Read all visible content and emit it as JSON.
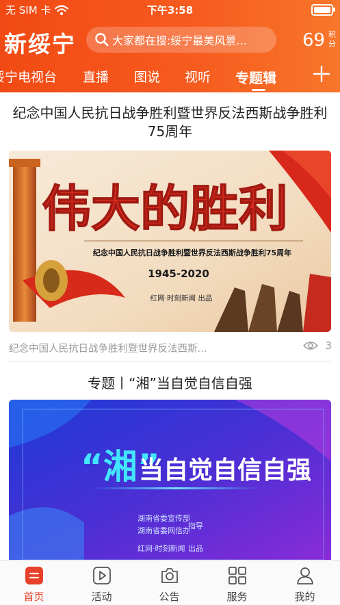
{
  "status_bar": {
    "carrier": "无 SIM 卡",
    "time": "下午3:58"
  },
  "header": {
    "logo": "新绥宁",
    "search_placeholder": "大家都在搜:绥宁最美风景...",
    "points_value": "69",
    "points_unit": "积分"
  },
  "tabs": [
    {
      "label": "绥宁电视台"
    },
    {
      "label": "直播"
    },
    {
      "label": "图说"
    },
    {
      "label": "视听"
    },
    {
      "label": "专题辑"
    }
  ],
  "active_tab": "专题辑",
  "feed": [
    {
      "title": "纪念中国人民抗日战争胜利暨世界反法西斯战争胜利75周年",
      "banner": {
        "headline": "伟大的胜利",
        "subtitle": "纪念中国人民抗日战争胜利暨世界反法西斯战争胜利75周年",
        "years": "1945-2020",
        "credit": "红网·时刻新闻 出品"
      },
      "caption": "纪念中国人民抗日战争胜利暨世界反法西斯...",
      "views": "3"
    },
    {
      "title": "专题丨“湘”当自觉自信自强",
      "banner": {
        "headline_quote": "“湘”",
        "headline_rest": "当自觉自信自强",
        "org1": "湖南省委宣传部",
        "org2": "湖南省委网信办",
        "guide": "指导",
        "credit_org": "红网·时刻新闻",
        "credit": "出品"
      }
    }
  ],
  "bottom_nav": [
    {
      "label": "首页",
      "icon": "home-icon"
    },
    {
      "label": "活动",
      "icon": "play-icon"
    },
    {
      "label": "公告",
      "icon": "camera-icon"
    },
    {
      "label": "服务",
      "icon": "grid-icon"
    },
    {
      "label": "我的",
      "icon": "user-icon"
    }
  ],
  "colors": {
    "brand": "#f24a14",
    "active_nav": "#e8412b",
    "muted_text": "#9a9a9a"
  }
}
